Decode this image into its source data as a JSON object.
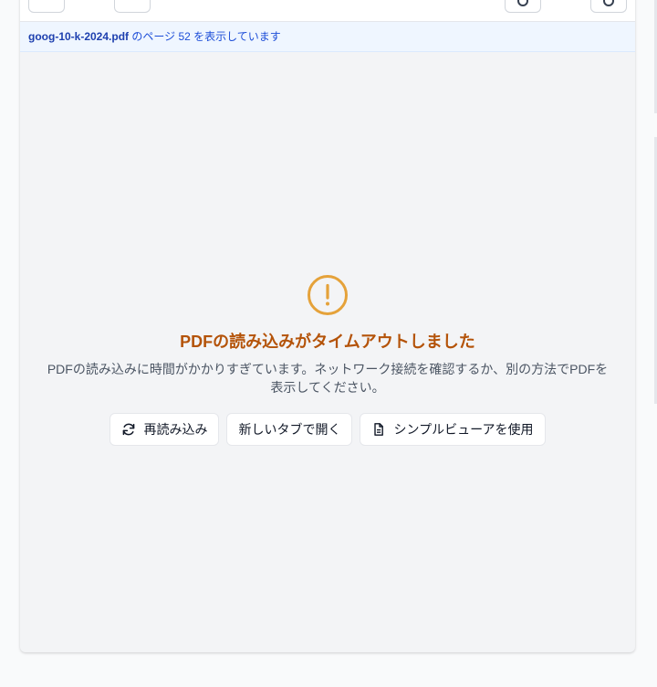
{
  "infobar": {
    "filename": "goog-10-k-2024.pdf",
    "suffix": "のページ 52 を表示しています"
  },
  "error": {
    "icon": "alert-circle-icon",
    "title": "PDFの読み込みがタイムアウトしました",
    "message": "PDFの読み込みに時間がかかりすぎています。ネットワーク接続を確認するか、別の方法でPDFを表示してください。"
  },
  "actions": {
    "reload_label": "再読み込み",
    "reload_icon": "refresh-icon",
    "new_tab_label": "新しいタブで開く",
    "simple_viewer_label": "シンプルビューアを使用",
    "simple_viewer_icon": "document-icon"
  },
  "colors": {
    "warning": "#e5a23a",
    "title": "#b45309",
    "info_bg": "#eff6ff",
    "info_text": "#1d4ed8"
  }
}
